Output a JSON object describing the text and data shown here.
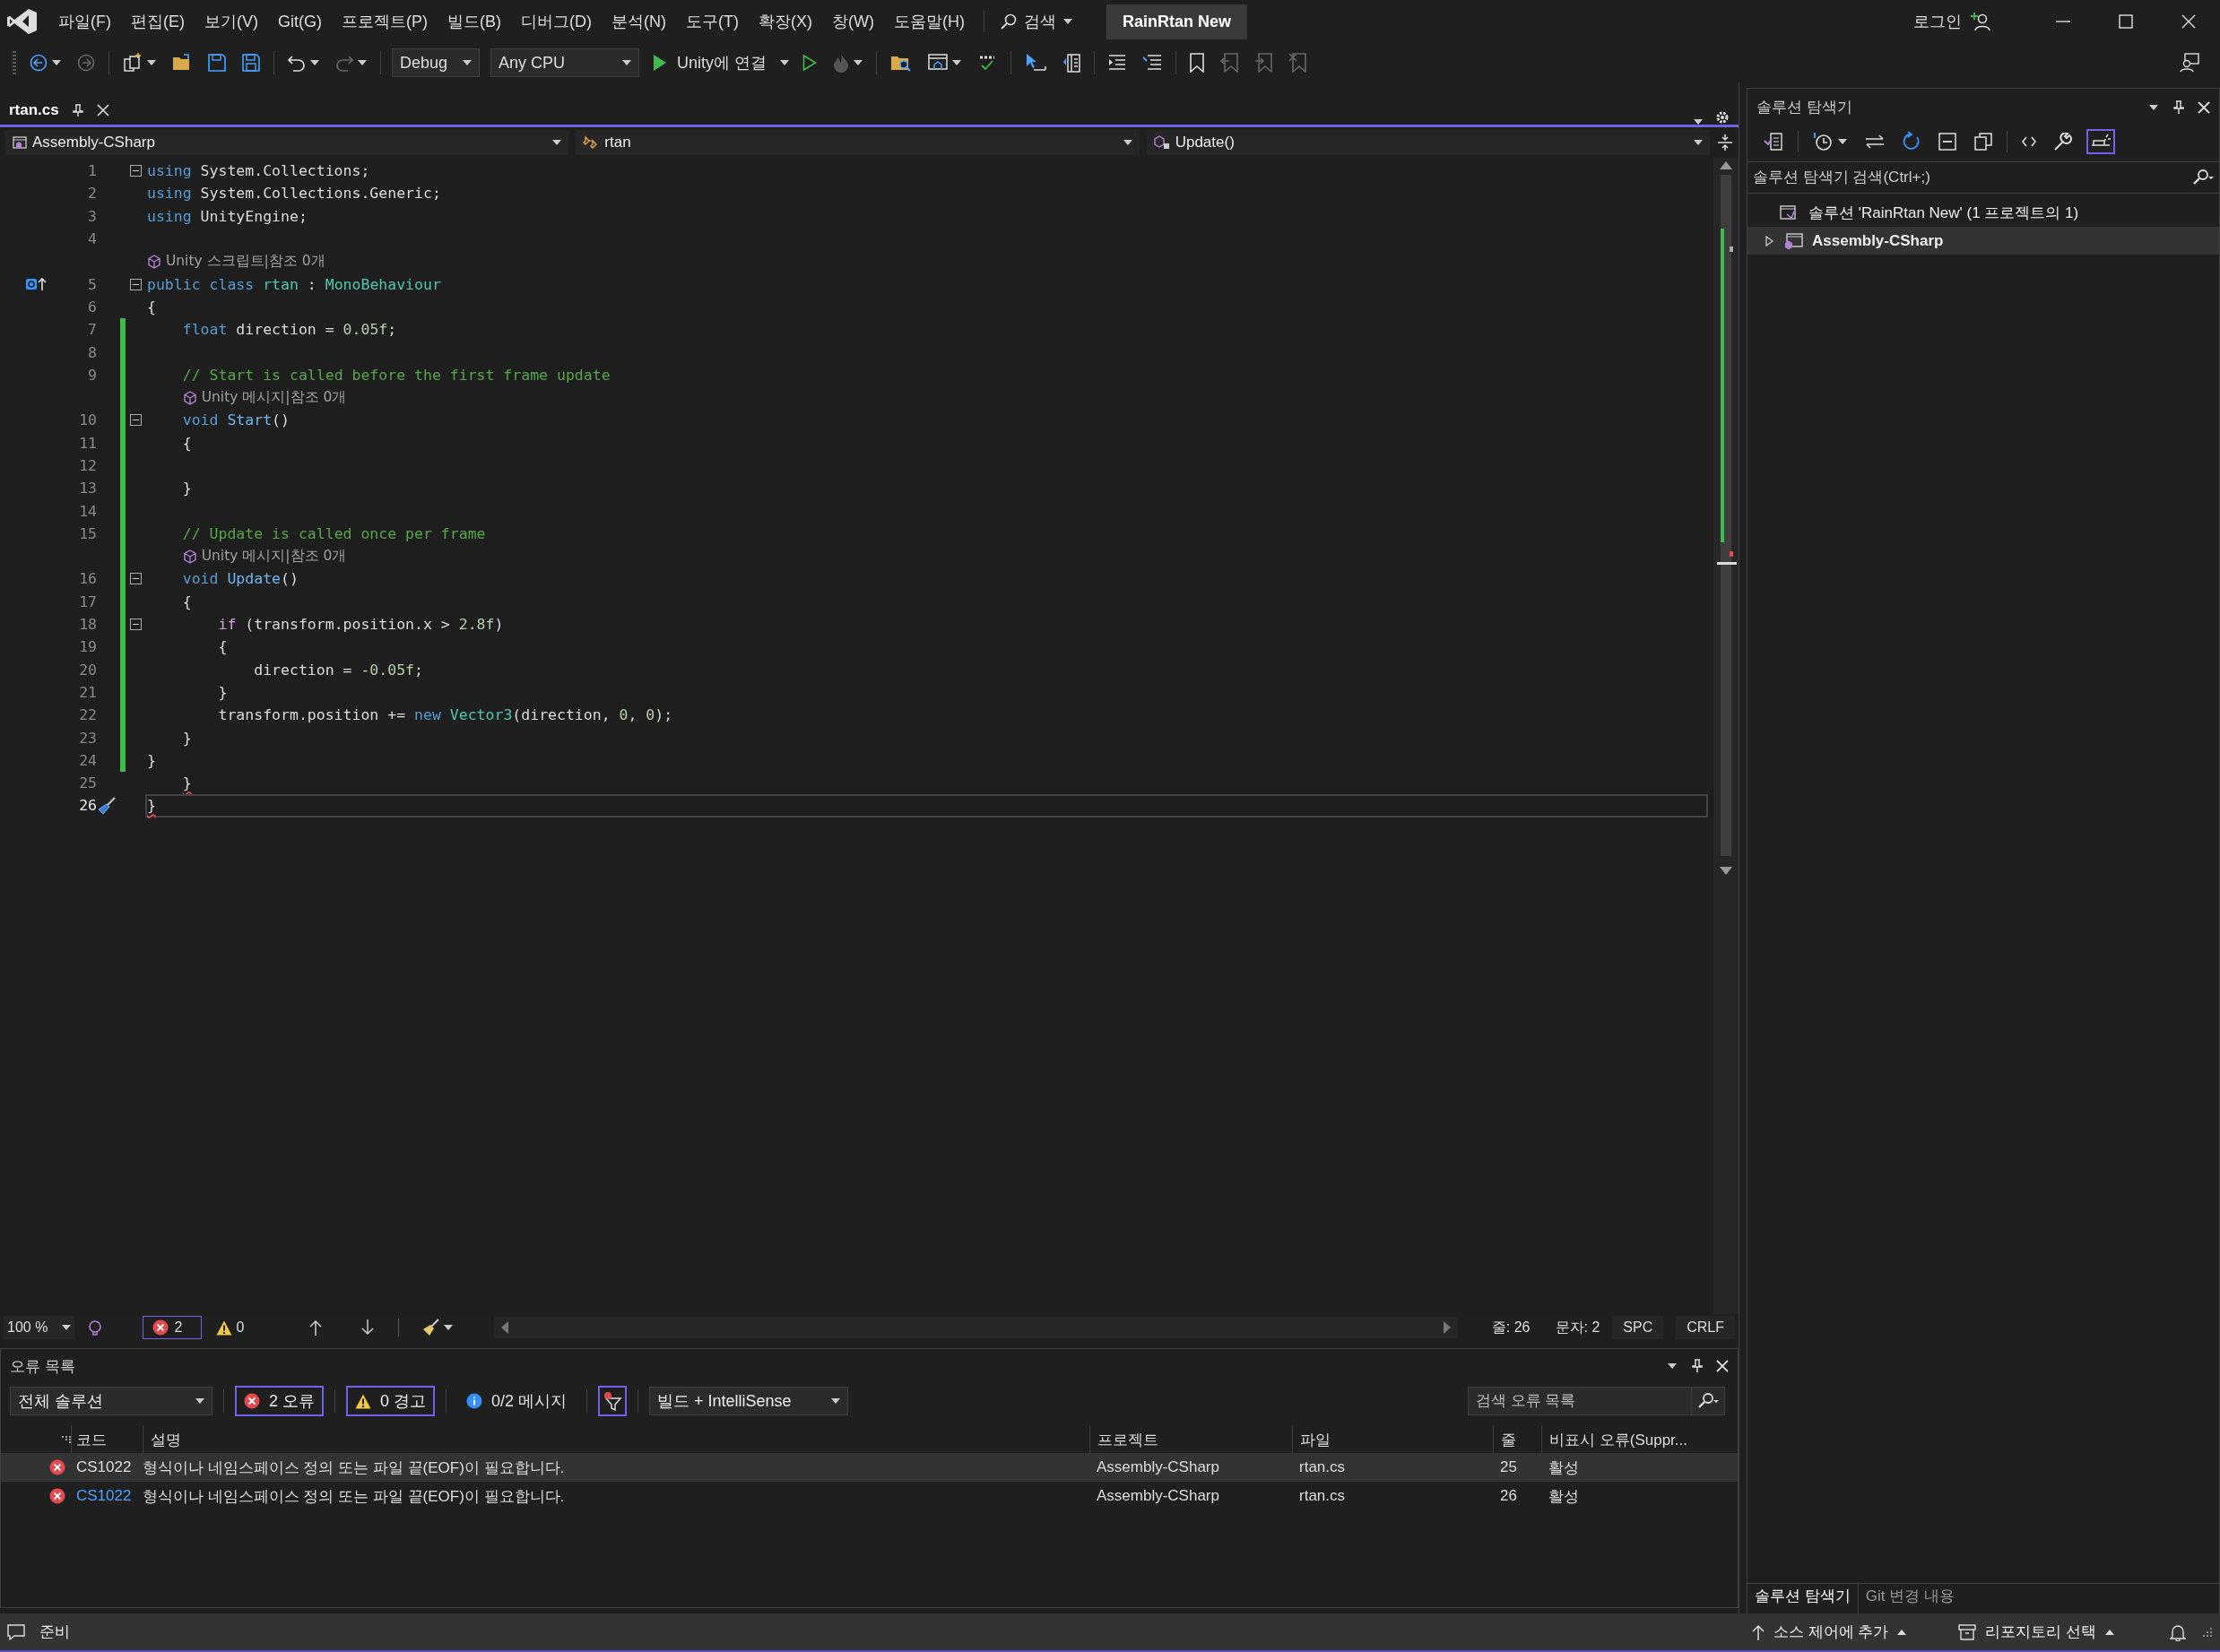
{
  "menu": [
    {
      "label": "파일(F)"
    },
    {
      "label": "편집(E)"
    },
    {
      "label": "보기(V)"
    },
    {
      "label": "Git(G)"
    },
    {
      "label": "프로젝트(P)"
    },
    {
      "label": "빌드(B)"
    },
    {
      "label": "디버그(D)"
    },
    {
      "label": "분석(N)"
    },
    {
      "label": "도구(T)"
    },
    {
      "label": "확장(X)"
    },
    {
      "label": "창(W)"
    },
    {
      "label": "도움말(H)"
    }
  ],
  "search": {
    "label": "검색"
  },
  "solution_badge": "RainRtan New",
  "account": {
    "label": "로그인"
  },
  "toolbar": {
    "configuration": "Debug",
    "platform": "Any CPU",
    "run": "Unity에 연결"
  },
  "tabs": [
    {
      "label": "rtan.cs",
      "selected": true
    }
  ],
  "nav": [
    {
      "label": "Assembly-CSharp"
    },
    {
      "label": "rtan"
    },
    {
      "label": "Update()"
    }
  ],
  "editor": {
    "lines": [
      {
        "kind": "code",
        "number": "1",
        "changed": false,
        "fold": true,
        "current": false,
        "override": false,
        "quick_action": false,
        "tokens": [
          {
            "kind": "keyword",
            "text": "using"
          },
          {
            "kind": "plain",
            "text": " System.Collections;"
          }
        ]
      },
      {
        "kind": "code",
        "number": "2",
        "changed": false,
        "fold": false,
        "current": false,
        "override": false,
        "quick_action": false,
        "tokens": [
          {
            "kind": "keyword",
            "text": "using"
          },
          {
            "kind": "plain",
            "text": " System.Collections.Generic;"
          }
        ]
      },
      {
        "kind": "code",
        "number": "3",
        "changed": false,
        "fold": false,
        "current": false,
        "override": false,
        "quick_action": false,
        "tokens": [
          {
            "kind": "keyword",
            "text": "using"
          },
          {
            "kind": "plain",
            "text": " UnityEngine;"
          }
        ]
      },
      {
        "kind": "code",
        "number": "4",
        "changed": false,
        "fold": false,
        "current": false,
        "override": false,
        "quick_action": false
      },
      {
        "kind": "codelens",
        "text": "Unity 스크립트|참조 0개"
      },
      {
        "kind": "code",
        "number": "5",
        "changed": false,
        "fold": true,
        "current": false,
        "override": true,
        "quick_action": false,
        "tokens": [
          {
            "kind": "keyword",
            "text": "public class"
          },
          {
            "kind": "type",
            "text": " rtan"
          },
          {
            "kind": "plain",
            "text": " : "
          },
          {
            "kind": "type",
            "text": "MonoBehaviour"
          }
        ]
      },
      {
        "kind": "code",
        "number": "6",
        "changed": false,
        "fold": false,
        "current": false,
        "override": false,
        "quick_action": false,
        "tokens": [
          {
            "kind": "plain",
            "text": "{"
          }
        ]
      },
      {
        "kind": "code",
        "number": "7",
        "changed": true,
        "fold": false,
        "current": false,
        "override": false,
        "quick_action": false,
        "tokens": [
          {
            "kind": "keyword",
            "text": "    float"
          },
          {
            "kind": "plain",
            "text": " direction = "
          },
          {
            "kind": "number",
            "text": "0.05f"
          },
          {
            "kind": "plain",
            "text": ";"
          }
        ]
      },
      {
        "kind": "code",
        "number": "8",
        "changed": true,
        "fold": false,
        "current": false,
        "override": false,
        "quick_action": false
      },
      {
        "kind": "code",
        "number": "9",
        "changed": true,
        "fold": false,
        "current": false,
        "override": false,
        "quick_action": false,
        "tokens": [
          {
            "kind": "comment",
            "text": "    // Start is called before the first frame update"
          }
        ]
      },
      {
        "kind": "codelens",
        "text": "Unity 메시지|참조 0개"
      },
      {
        "kind": "code",
        "number": "10",
        "changed": true,
        "fold": true,
        "current": false,
        "override": false,
        "quick_action": false,
        "tokens": [
          {
            "kind": "keyword",
            "text": "    void"
          },
          {
            "kind": "method",
            "text": " Start"
          },
          {
            "kind": "plain",
            "text": "()"
          }
        ]
      },
      {
        "kind": "code",
        "number": "11",
        "changed": true,
        "fold": false,
        "current": false,
        "override": false,
        "quick_action": false,
        "tokens": [
          {
            "kind": "plain",
            "text": "    {"
          }
        ]
      },
      {
        "kind": "code",
        "number": "12",
        "changed": true,
        "fold": false,
        "current": false,
        "override": false,
        "quick_action": false
      },
      {
        "kind": "code",
        "number": "13",
        "changed": true,
        "fold": false,
        "current": false,
        "override": false,
        "quick_action": false,
        "tokens": [
          {
            "kind": "plain",
            "text": "    }"
          }
        ]
      },
      {
        "kind": "code",
        "number": "14",
        "changed": true,
        "fold": false,
        "current": false,
        "override": false,
        "quick_action": false
      },
      {
        "kind": "code",
        "number": "15",
        "changed": true,
        "fold": false,
        "current": false,
        "override": false,
        "quick_action": false,
        "tokens": [
          {
            "kind": "comment",
            "text": "    // Update is called once per frame"
          }
        ]
      },
      {
        "kind": "codelens",
        "text": "Unity 메시지|참조 0개"
      },
      {
        "kind": "code",
        "number": "16",
        "changed": true,
        "fold": true,
        "current": false,
        "override": false,
        "quick_action": false,
        "tokens": [
          {
            "kind": "keyword",
            "text": "    void"
          },
          {
            "kind": "method",
            "text": " Update"
          },
          {
            "kind": "plain",
            "text": "()"
          }
        ]
      },
      {
        "kind": "code",
        "number": "17",
        "changed": true,
        "fold": false,
        "current": false,
        "override": false,
        "quick_action": false,
        "tokens": [
          {
            "kind": "plain",
            "text": "    {"
          }
        ]
      },
      {
        "kind": "code",
        "number": "18",
        "changed": true,
        "fold": true,
        "current": false,
        "override": false,
        "quick_action": false,
        "tokens": [
          {
            "kind": "control",
            "text": "        if"
          },
          {
            "kind": "plain",
            "text": " (transform.position.x > "
          },
          {
            "kind": "number",
            "text": "2.8f"
          },
          {
            "kind": "plain",
            "text": ")"
          }
        ]
      },
      {
        "kind": "code",
        "number": "19",
        "changed": true,
        "fold": false,
        "current": false,
        "override": false,
        "quick_action": false,
        "tokens": [
          {
            "kind": "plain",
            "text": "        {"
          }
        ]
      },
      {
        "kind": "code",
        "number": "20",
        "changed": true,
        "fold": false,
        "current": false,
        "override": false,
        "quick_action": false,
        "tokens": [
          {
            "kind": "plain",
            "text": "            direction = -"
          },
          {
            "kind": "number",
            "text": "0.05f"
          },
          {
            "kind": "plain",
            "text": ";"
          }
        ]
      },
      {
        "kind": "code",
        "number": "21",
        "changed": true,
        "fold": false,
        "current": false,
        "override": false,
        "quick_action": false,
        "tokens": [
          {
            "kind": "plain",
            "text": "        }"
          }
        ]
      },
      {
        "kind": "code",
        "number": "22",
        "changed": true,
        "fold": false,
        "current": false,
        "override": false,
        "quick_action": false,
        "tokens": [
          {
            "kind": "plain",
            "text": "        transform.position += "
          },
          {
            "kind": "keyword",
            "text": "new"
          },
          {
            "kind": "type",
            "text": " Vector3"
          },
          {
            "kind": "plain",
            "text": "(direction, "
          },
          {
            "kind": "number",
            "text": "0"
          },
          {
            "kind": "plain",
            "text": ", "
          },
          {
            "kind": "number",
            "text": "0"
          },
          {
            "kind": "plain",
            "text": ");"
          }
        ]
      },
      {
        "kind": "code",
        "number": "23",
        "changed": true,
        "fold": false,
        "current": false,
        "override": false,
        "quick_action": false,
        "tokens": [
          {
            "kind": "plain",
            "text": "    }"
          }
        ]
      },
      {
        "kind": "code",
        "number": "24",
        "changed": true,
        "fold": false,
        "current": false,
        "override": false,
        "quick_action": false,
        "tokens": [
          {
            "kind": "plain",
            "text": "}"
          }
        ]
      },
      {
        "kind": "code",
        "number": "25",
        "changed": false,
        "fold": false,
        "current": false,
        "override": false,
        "quick_action": false,
        "tokens": [
          {
            "kind": "error",
            "text": "    }"
          }
        ]
      },
      {
        "kind": "code",
        "number": "26",
        "changed": false,
        "fold": false,
        "current": true,
        "override": false,
        "quick_action": true,
        "tokens": [
          {
            "kind": "error",
            "text": "}"
          }
        ]
      }
    ]
  },
  "editor_status": {
    "zoom": "100 %",
    "errors": "2",
    "warnings": "0",
    "line": "줄: 26",
    "column": "문자: 2",
    "whitespace": "SPC",
    "line_ending": "CRLF"
  },
  "error_list": {
    "title": "오류 목록",
    "scope": "전체 솔루션",
    "filters": [
      {
        "kind": "error",
        "label": "2 오류",
        "selected": true
      },
      {
        "kind": "warning",
        "label": "0 경고",
        "selected": true
      },
      {
        "kind": "info",
        "label": "0/2 메시지",
        "selected": false
      }
    ],
    "source": "빌드 + IntelliSense",
    "search": {
      "placeholder": "검색 오류 목록"
    },
    "columns": [
      "코드",
      "설명",
      "프로젝트",
      "파일",
      "줄",
      "비표시 오류(Suppr..."
    ],
    "rows": [
      {
        "selected": true,
        "code": "CS1022",
        "description": "형식이나 네임스페이스 정의 또는 파일 끝(EOF)이 필요합니다.",
        "project": "Assembly-CSharp",
        "file": "rtan.cs",
        "line": "25",
        "state": "활성"
      },
      {
        "selected": false,
        "code": "CS1022",
        "description": "형식이나 네임스페이스 정의 또는 파일 끝(EOF)이 필요합니다.",
        "project": "Assembly-CSharp",
        "file": "rtan.cs",
        "line": "26",
        "state": "활성"
      }
    ]
  },
  "solution_explorer": {
    "title": "솔루션 탐색기",
    "search": {
      "placeholder": "솔루션 탐색기 검색(Ctrl+;)"
    },
    "tree": [
      {
        "label": "솔루션 'RainRtan New' (1 프로젝트의 1)",
        "selected": false,
        "expanded": true,
        "children": [
          {
            "label": "Assembly-CSharp",
            "selected": true,
            "expanded": false
          }
        ]
      }
    ],
    "tabs": [
      {
        "label": "솔루션 탐색기",
        "selected": true
      },
      {
        "label": "Git 변경 내용",
        "selected": false
      }
    ]
  },
  "status_bar": {
    "message": "준비",
    "source_control": "소스 제어에 추가",
    "repository": "리포지토리 선택"
  }
}
